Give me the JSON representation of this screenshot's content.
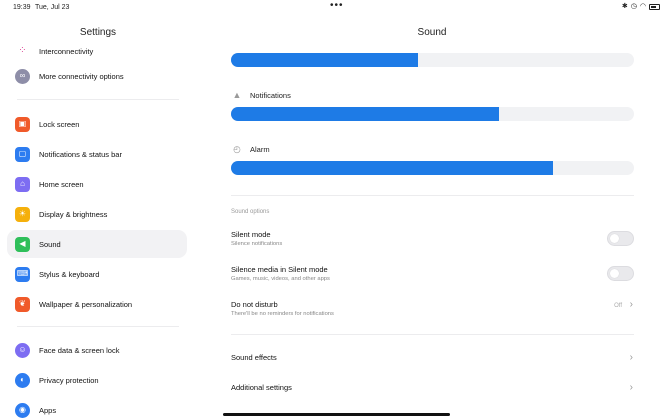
{
  "status_bar": {
    "time": "19:39",
    "date": "Tue, Jul 23",
    "dots": "•••"
  },
  "sidebar": {
    "title": "Settings",
    "items": [
      {
        "label": "Interconnectivity",
        "icon": "interconnectivity-icon",
        "color": "#ffffff"
      },
      {
        "label": "More connectivity options",
        "icon": "link-icon",
        "color": "#8e8ea8"
      },
      {
        "label": "Lock screen",
        "icon": "lock-icon",
        "color": "#f05a2a"
      },
      {
        "label": "Notifications & status bar",
        "icon": "notifications-icon",
        "color": "#2d7cf0"
      },
      {
        "label": "Home screen",
        "icon": "home-icon",
        "color": "#7d6df2"
      },
      {
        "label": "Display & brightness",
        "icon": "brightness-icon",
        "color": "#f5b00c"
      },
      {
        "label": "Sound",
        "icon": "speaker-icon",
        "color": "#2fbf5a"
      },
      {
        "label": "Stylus & keyboard",
        "icon": "keyboard-icon",
        "color": "#2d7cf0"
      },
      {
        "label": "Wallpaper & personalization",
        "icon": "wallpaper-icon",
        "color": "#f05a2a"
      },
      {
        "label": "Face data & screen lock",
        "icon": "face-icon",
        "color": "#7d6df2"
      },
      {
        "label": "Privacy protection",
        "icon": "privacy-icon",
        "color": "#2d7cf0"
      },
      {
        "label": "Apps",
        "icon": "apps-icon",
        "color": "#2d7cf0"
      }
    ]
  },
  "main": {
    "title": "Sound",
    "volumes": [
      {
        "label": "",
        "level": 0.465
      },
      {
        "label": "Notifications",
        "icon": "bell-icon",
        "level": 0.665
      },
      {
        "label": "Alarm",
        "icon": "alarm-icon",
        "level": 0.8
      }
    ],
    "section_header": "Sound options",
    "rows": [
      {
        "title": "Silent mode",
        "subtitle": "Silence notifications"
      },
      {
        "title": "Silence media in Silent mode",
        "subtitle": "Games, music, videos, and other apps"
      },
      {
        "title": "Do not disturb",
        "subtitle": "There'll be no reminders for notifications",
        "value": "Off"
      },
      {
        "title": "Sound effects"
      },
      {
        "title": "Additional settings"
      }
    ]
  },
  "colors": {
    "accent": "#1e7be6",
    "track": "#f1f2f4"
  }
}
